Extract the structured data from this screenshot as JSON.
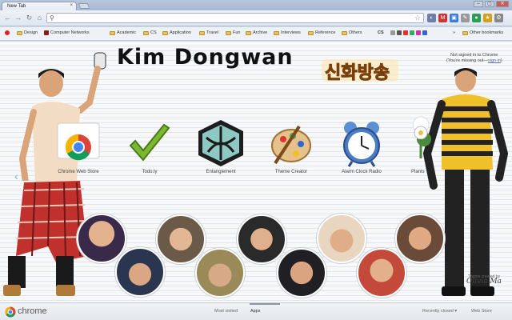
{
  "browser": {
    "tab_title": "New Tab",
    "tab_close": "×",
    "window_buttons": [
      "–",
      "▢",
      "✕"
    ]
  },
  "toolbar": {
    "back": "←",
    "forward": "→",
    "reload": "↻",
    "home": "⌂",
    "omnibox_value": "",
    "star": "☆"
  },
  "bookmarks": {
    "items": [
      "Design",
      "Computer Networks",
      "Academic",
      "CS",
      "Application",
      "Travel",
      "Fun",
      "Archive",
      "Interviews",
      "Reference",
      "Others"
    ],
    "cs_label": "CS",
    "overflow": "»",
    "other_bookmarks": "Other bookmarks"
  },
  "page": {
    "title": "Kim Dongwan",
    "logo_text": "신화방송",
    "sign_in_line1": "Not signed in to Chrome",
    "sign_in_line2": "(You're missing out—",
    "sign_in_link": "sign in",
    "sign_in_end": ")",
    "left_arrow": "‹",
    "apps": [
      {
        "label": "Chrome Web Store",
        "icon": "chrome-web-store-icon"
      },
      {
        "label": "Todo.ly",
        "icon": "checkmark-icon"
      },
      {
        "label": "Entanglement",
        "icon": "hexagon-icon"
      },
      {
        "label": "Theme Creator",
        "icon": "palette-icon"
      },
      {
        "label": "Alarm Clock Radio",
        "icon": "alarm-clock-icon"
      },
      {
        "label": "Plants",
        "icon": "plant-icon"
      }
    ],
    "credit_line1": "Theme created by",
    "credit_signature": "Olivia Ma"
  },
  "bottom": {
    "brand": "chrome",
    "most_visited": "Most visited",
    "apps": "Apps",
    "recently_closed": "Recently closed ▾",
    "web_store": "Web Store"
  },
  "colors": {
    "accent_green": "#7cb82f",
    "tab_bg": "#e5eaf2",
    "title_color": "#111111"
  }
}
